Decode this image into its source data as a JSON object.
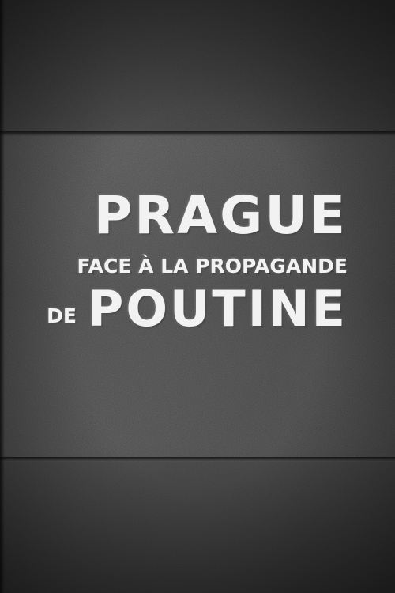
{
  "poster": {
    "title_line1": "PRAGUE",
    "title_line2": "FACE À LA PROPAGANDE",
    "title_line3_prefix": "DE",
    "title_line3_main": "POUTINE"
  },
  "colors": {
    "text": "#f2f2f2",
    "background": "#3d3d3d"
  }
}
